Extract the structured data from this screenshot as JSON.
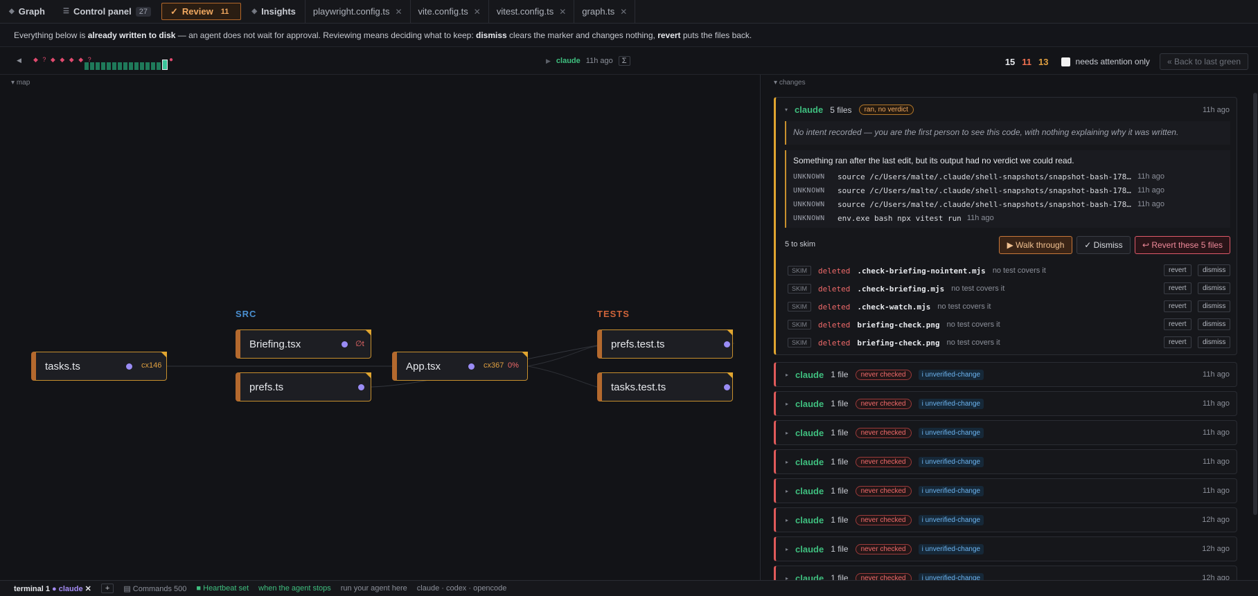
{
  "tabs": {
    "graph": {
      "label": "Graph",
      "icon": "diamond-icon"
    },
    "control_panel": {
      "label": "Control panel",
      "count": "27",
      "icon": "menu-icon"
    },
    "review": {
      "label": "Review",
      "count": "11",
      "icon": "check-icon"
    },
    "insights": {
      "label": "Insights",
      "icon": "diamond-icon"
    },
    "files": [
      "playwright.config.ts",
      "vite.config.ts",
      "vitest.config.ts",
      "graph.ts"
    ],
    "close_glyph": "✕"
  },
  "banner": {
    "p1": "Everything below is ",
    "b1": "already written to disk",
    "p2": " — an agent does not wait for approval. Reviewing means deciding what to keep: ",
    "b2": "dismiss",
    "p3": " clears the marker and changes nothing, ",
    "b3": "revert",
    "p4": " puts the files back."
  },
  "timeline": {
    "marks": "◆ ? ◆ ◆ ◆ ◆ ?",
    "agent": "claude",
    "ago": "11h ago",
    "sigma": "Σ",
    "count_total": "15",
    "count_red": "11",
    "count_orange": "13",
    "needs_attention_label": "needs attention only",
    "back_label": "« Back to last green"
  },
  "map": {
    "label": "map",
    "groups": {
      "src": "SRC",
      "tests": "TESTS"
    },
    "nodes": {
      "tasks": {
        "label": "tasks.ts",
        "meta": "cx146"
      },
      "briefing": {
        "label": "Briefing.tsx",
        "meta": "∅t"
      },
      "prefs": {
        "label": "prefs.ts"
      },
      "app": {
        "label": "App.tsx",
        "meta": "cx367",
        "meta2": "0%"
      },
      "prefs_test": {
        "label": "prefs.test.ts"
      },
      "tasks_test": {
        "label": "tasks.test.ts"
      }
    }
  },
  "changes": {
    "label": "changes",
    "expanded": {
      "agent": "claude",
      "files": "5 files",
      "badge": "ran, no verdict",
      "ago": "11h ago",
      "intent": "No intent recorded — you are the first person to see this code, with nothing explaining why it was written.",
      "run_title": "Something ran after the last edit, but its output had no verdict we could read.",
      "runs": [
        {
          "status": "UNKNOWN",
          "cmd": "source /c/Users/malte/.claude/shell-snapshots/snapshot-bash-17871605538...",
          "ago": "11h ago"
        },
        {
          "status": "UNKNOWN",
          "cmd": "source /c/Users/malte/.claude/shell-snapshots/snapshot-bash-17871605538...",
          "ago": "11h ago"
        },
        {
          "status": "UNKNOWN",
          "cmd": "source /c/Users/malte/.claude/shell-snapshots/snapshot-bash-17871605538...",
          "ago": "11h ago"
        },
        {
          "status": "UNKNOWN",
          "cmd": "env.exe bash npx vitest run",
          "ago": "11h ago"
        }
      ],
      "skim_count": "5 to skim",
      "walk_label": "▶ Walk through",
      "dismiss_label": "✓ Dismiss",
      "revert_label": "↩ Revert these 5 files",
      "file_rows": [
        {
          "tag": "SKIM",
          "action": "deleted",
          "name": ".check-briefing-nointent.mjs",
          "note": "no test covers it"
        },
        {
          "tag": "SKIM",
          "action": "deleted",
          "name": ".check-briefing.mjs",
          "note": "no test covers it"
        },
        {
          "tag": "SKIM",
          "action": "deleted",
          "name": ".check-watch.mjs",
          "note": "no test covers it"
        },
        {
          "tag": "SKIM",
          "action": "deleted",
          "name": "briefing-check.png",
          "note": "no test covers it"
        },
        {
          "tag": "SKIM",
          "action": "deleted",
          "name": "briefing-check.png",
          "note": "no test covers it"
        }
      ],
      "row_revert": "revert",
      "row_dismiss": "dismiss"
    },
    "collapsed": [
      {
        "agent": "claude",
        "files": "1 file",
        "badge": "never checked",
        "tag": "i unverified-change",
        "ago": "11h ago"
      },
      {
        "agent": "claude",
        "files": "1 file",
        "badge": "never checked",
        "tag": "i unverified-change",
        "ago": "11h ago"
      },
      {
        "agent": "claude",
        "files": "1 file",
        "badge": "never checked",
        "tag": "i unverified-change",
        "ago": "11h ago"
      },
      {
        "agent": "claude",
        "files": "1 file",
        "badge": "never checked",
        "tag": "i unverified-change",
        "ago": "11h ago"
      },
      {
        "agent": "claude",
        "files": "1 file",
        "badge": "never checked",
        "tag": "i unverified-change",
        "ago": "11h ago"
      },
      {
        "agent": "claude",
        "files": "1 file",
        "badge": "never checked",
        "tag": "i unverified-change",
        "ago": "12h ago"
      },
      {
        "agent": "claude",
        "files": "1 file",
        "badge": "never checked",
        "tag": "i unverified-change",
        "ago": "12h ago"
      },
      {
        "agent": "claude",
        "files": "1 file",
        "badge": "never checked",
        "tag": "i unverified-change",
        "ago": "12h ago"
      }
    ]
  },
  "bottom": {
    "terminal": "terminal 1",
    "terminal_agent": "● claude",
    "close": "✕",
    "plus": "+",
    "commands": "▤ Commands  500",
    "heartbeat": "■ Heartbeat set",
    "when": "when the agent stops",
    "run_here": "run your agent here",
    "agents": "claude · codex · opencode"
  }
}
